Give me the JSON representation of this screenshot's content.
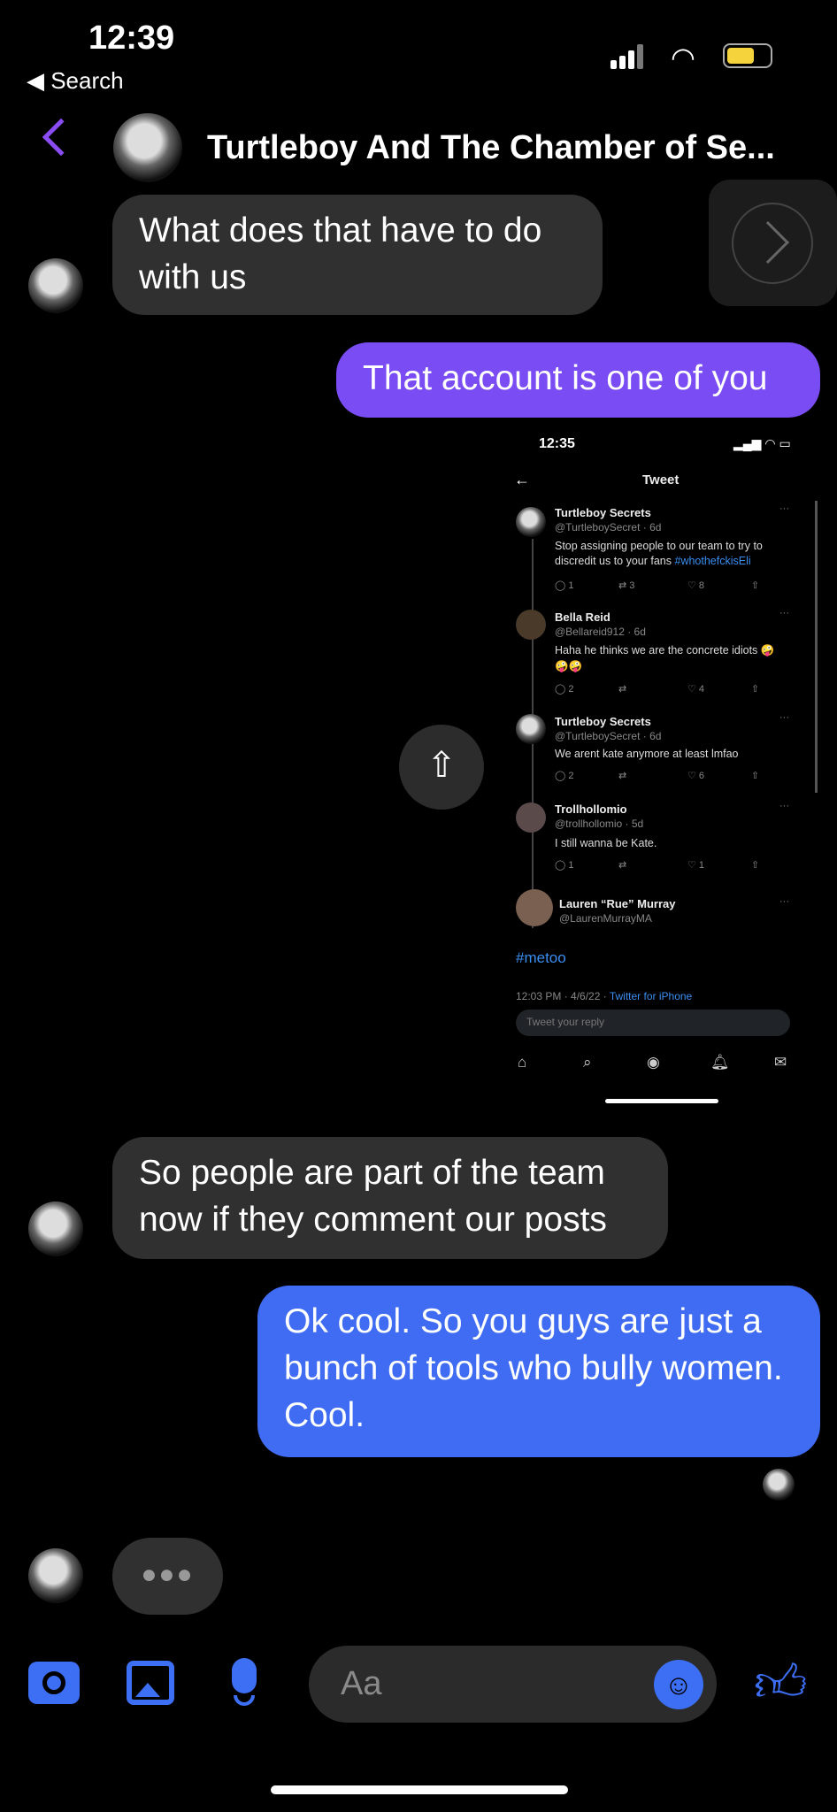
{
  "status_bar": {
    "time": "12:39",
    "back_label": "◀ Search"
  },
  "header": {
    "title": "Turtleboy And The Chamber of Se..."
  },
  "messages": [
    {
      "from": "them",
      "text": "What does that have to do with us"
    },
    {
      "from": "me",
      "text": "That account is one of you"
    },
    {
      "from": "them",
      "text": "So people are part of the team now if they comment our posts"
    },
    {
      "from": "me",
      "text": "Ok cool. So you guys are just a bunch of tools who bully women. Cool."
    }
  ],
  "shared_screenshot": {
    "time": "12:35",
    "title": "Tweet",
    "tweets": [
      {
        "name": "Turtleboy Secrets",
        "handle": "@TurtleboySecret · 6d",
        "text1": "Stop assigning people to our team to try to",
        "text2": "discredit us to your fans",
        "hashtag": "#whothefckisEli",
        "replies": "1",
        "retweets": "3",
        "likes": "8"
      },
      {
        "name": "Bella Reid",
        "handle": "@Bellareid912 · 6d",
        "text1": "Haha he thinks we are the concrete idiots 🤪",
        "text2": "🤪🤪",
        "replies": "2",
        "retweets": "",
        "likes": "4"
      },
      {
        "name": "Turtleboy Secrets",
        "handle": "@TurtleboySecret · 6d",
        "text1": "We arent kate anymore at least lmfao",
        "replies": "2",
        "retweets": "",
        "likes": "6"
      },
      {
        "name": "Trollhollomio",
        "handle": "@trollhollomio · 5d",
        "text1": "I still wanna be Kate.",
        "replies": "1",
        "retweets": "",
        "likes": "1"
      }
    ],
    "main": {
      "name": "Lauren “Rue” Murray",
      "handle": "@LaurenMurrayMA",
      "text": "#metoo",
      "timestamp": "12:03 PM · 4/6/22 · ",
      "source": "Twitter for iPhone"
    },
    "reply_placeholder": "Tweet your reply"
  },
  "composer": {
    "placeholder": "Aa"
  },
  "colors": {
    "purple": "#7a4cf3",
    "blue": "#3f6cf2",
    "accent": "#3d6ff5"
  }
}
